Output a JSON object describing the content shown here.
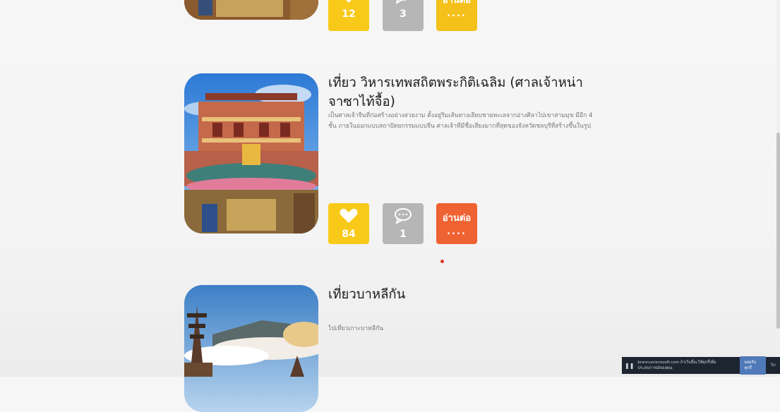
{
  "cards": [
    {
      "title": "",
      "description": "",
      "likes": "12",
      "comments": "3",
      "read_more": "อ่านต่อ",
      "read_more_dots": "...."
    },
    {
      "title": "เที่ยว วิหารเทพสถิตพระกิติเฉลิม (ศาลเจ้าหน่าจาซาไท้จื้อ)",
      "description": "เป็นศาลเจ้าจีนที่ก่อสร้างอย่างสวยงาม ตั้งอยู่ริมเส้นทางเลียบชายทะเลจากอ่างศิลาไปเขาสามมุข มีอีก 4 ชั้น ภายในออกแบบสถาปัตยกรรมแบบจีน ศาลเจ้าที่มีชื่อเสียงมากที่สุดของจังหวัดชลบุรีที่สร้างขึ้นในรูป",
      "likes": "84",
      "comments": "1",
      "read_more": "อ่านต่อ",
      "read_more_dots": "...."
    },
    {
      "title": "เที่ยวบาหลีกัน",
      "description": "ไปเที่ยวเกาะบาหลีกัน"
    }
  ],
  "cookie_banner": {
    "text": "brannumicrosoft.com ถ้าเว็บนี้จะใช้คุกกี้เพื่อประสบการณ์ของคุณ",
    "accept_label": "ยอมรับคุกกี้",
    "close_label": "ปิด"
  },
  "colors": {
    "like": "#f9c91a",
    "comment": "#b6b6b6",
    "read_more": "#f4c01a",
    "read_more_hover": "#ef6231"
  }
}
